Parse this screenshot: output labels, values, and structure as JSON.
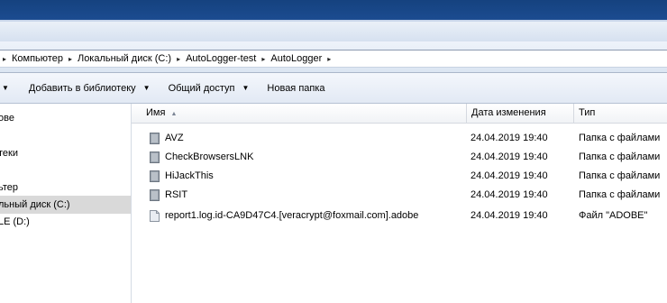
{
  "address": {
    "crumbs": [
      "Компьютер",
      "Локальный диск (C:)",
      "AutoLogger-test",
      "AutoLogger"
    ]
  },
  "toolbar": {
    "add_to_library_label": "Добавить в библиотеку",
    "share_label": "Общий доступ",
    "new_folder_label": "Новая папка"
  },
  "navpane": {
    "items": [
      "ове",
      "теки",
      "ьтер",
      "льный диск (C:)",
      "LE (D:)"
    ],
    "selected_index": 3
  },
  "columns": {
    "name": "Имя",
    "date": "Дата изменения",
    "type": "Тип"
  },
  "files": [
    {
      "name": "AVZ",
      "date": "24.04.2019 19:40",
      "type": "Папка с файлами",
      "icon": "folder-icon"
    },
    {
      "name": "CheckBrowsersLNK",
      "date": "24.04.2019 19:40",
      "type": "Папка с файлами",
      "icon": "folder-icon"
    },
    {
      "name": "HiJackThis",
      "date": "24.04.2019 19:40",
      "type": "Папка с файлами",
      "icon": "folder-icon"
    },
    {
      "name": "RSIT",
      "date": "24.04.2019 19:40",
      "type": "Папка с файлами",
      "icon": "folder-icon"
    },
    {
      "name": "report1.log.id-CA9D47C4.[veracrypt@foxmail.com].adobe",
      "date": "24.04.2019 19:40",
      "type": "Файл \"ADOBE\"",
      "icon": "file-icon"
    }
  ],
  "colors": {
    "titlebar": "#1f4f94",
    "selection": "#d9d9d9"
  }
}
